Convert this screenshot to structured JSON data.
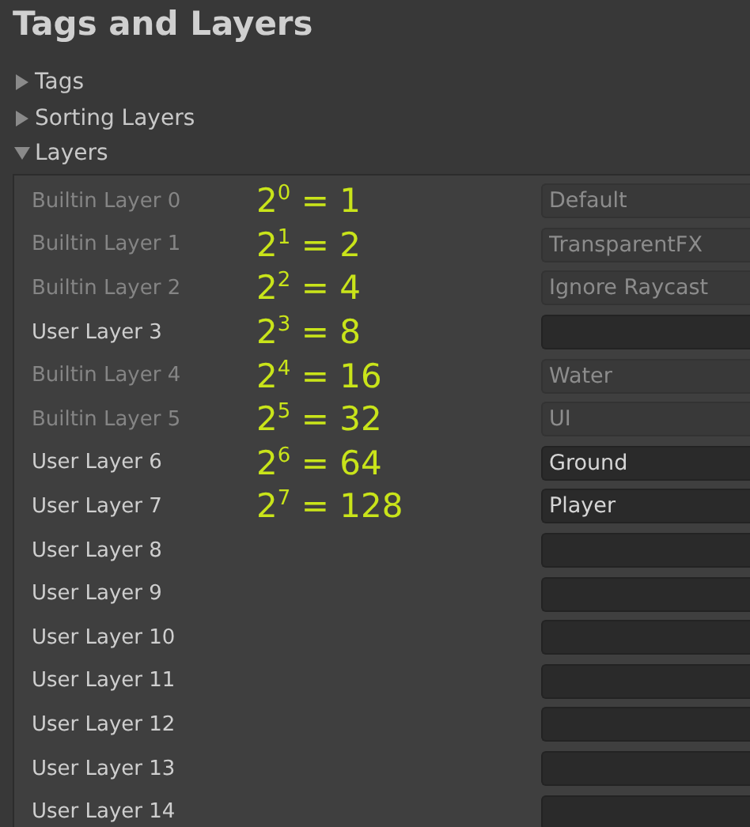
{
  "window": {
    "title": "Tags and Layers"
  },
  "sections": [
    {
      "label": "Tags",
      "expanded": false
    },
    {
      "label": "Sorting Layers",
      "expanded": false
    },
    {
      "label": "Layers",
      "expanded": true
    }
  ],
  "layers": [
    {
      "label": "Builtin Layer 0",
      "value": "Default",
      "disabled": true,
      "note": "2$^{0}$ = 1"
    },
    {
      "label": "Builtin Layer 1",
      "value": "TransparentFX",
      "disabled": true,
      "note": "2$^{1}$ = 2"
    },
    {
      "label": "Builtin Layer 2",
      "value": "Ignore Raycast",
      "disabled": true,
      "note": "2$^{2}$ = 4"
    },
    {
      "label": "User Layer 3",
      "disabled": false,
      "note": "2$^{3}$ = 8"
    },
    {
      "label": "Builtin Layer 4",
      "value": "Water",
      "disabled": true,
      "note": "2$^{4}$ = 16"
    },
    {
      "label": "Builtin Layer 5",
      "value": "UI",
      "disabled": true,
      "note": "2$^{5}$ = 32"
    },
    {
      "label": "User Layer 6",
      "value": "Ground",
      "disabled": false,
      "note": "2$^{6}$ = 64"
    },
    {
      "label": "User Layer 7",
      "value": "Player",
      "disabled": false,
      "note": "2$^{7}$ = 128"
    },
    {
      "label": "User Layer 8",
      "disabled": false
    },
    {
      "label": "User Layer 9",
      "disabled": false
    },
    {
      "label": "User Layer 10",
      "disabled": false
    },
    {
      "label": "User Layer 11",
      "disabled": false
    },
    {
      "label": "User Layer 12",
      "disabled": false
    },
    {
      "label": "User Layer 13",
      "disabled": false
    },
    {
      "label": "User Layer 14",
      "disabled": false
    }
  ]
}
